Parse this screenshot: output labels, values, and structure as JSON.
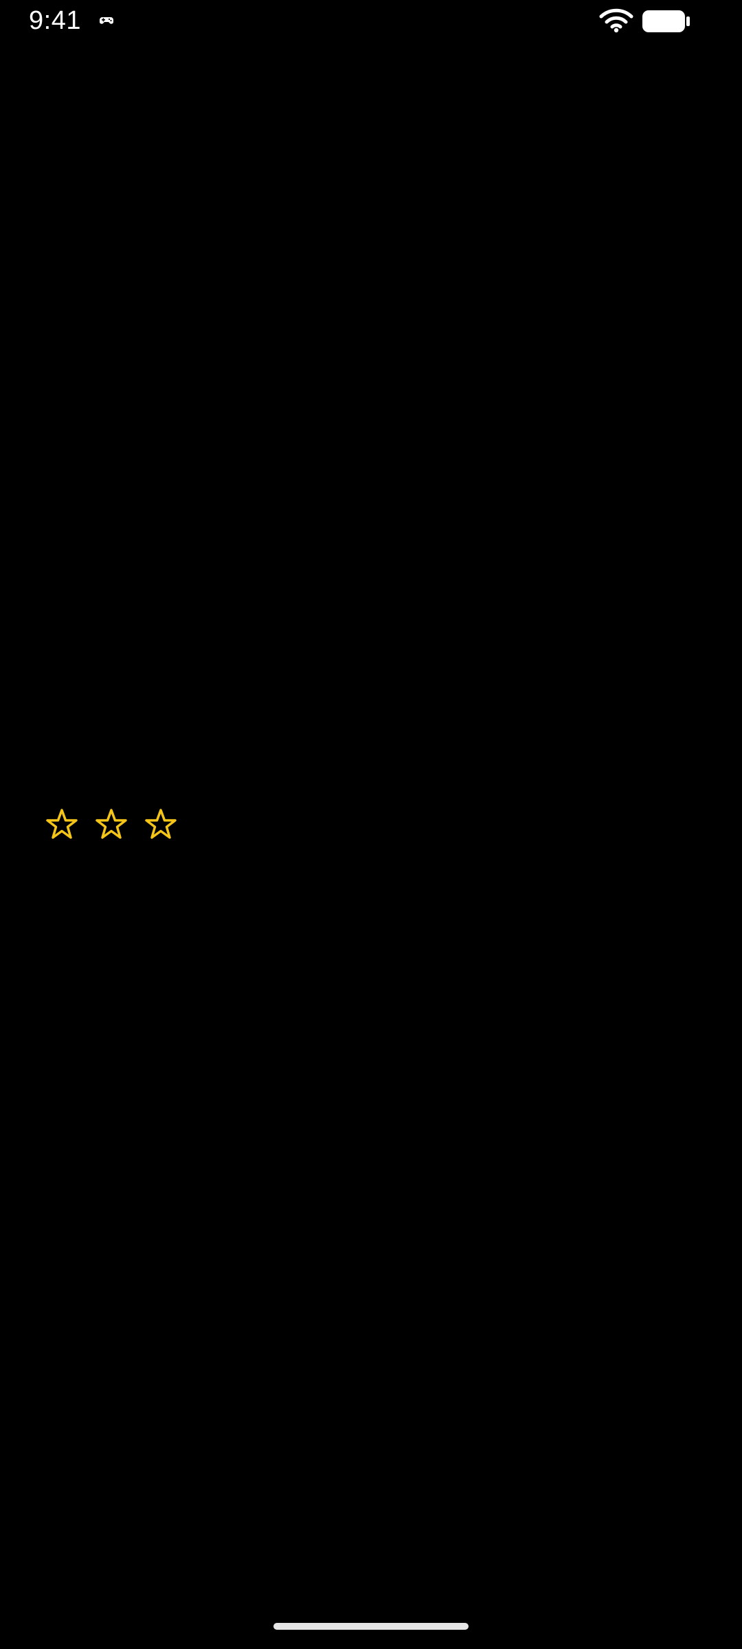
{
  "status_bar": {
    "time": "9:41",
    "notification_icon": "game-controller-icon",
    "wifi_icon": "wifi-icon",
    "battery_icon": "battery-icon"
  },
  "rating": {
    "stars_total": 3,
    "stars_filled": 0,
    "star_icon": "star-outline-icon",
    "star_color": "#F5C518"
  },
  "colors": {
    "background": "#000000",
    "foreground": "#FFFFFF",
    "home_indicator": "#E6E6E6"
  }
}
